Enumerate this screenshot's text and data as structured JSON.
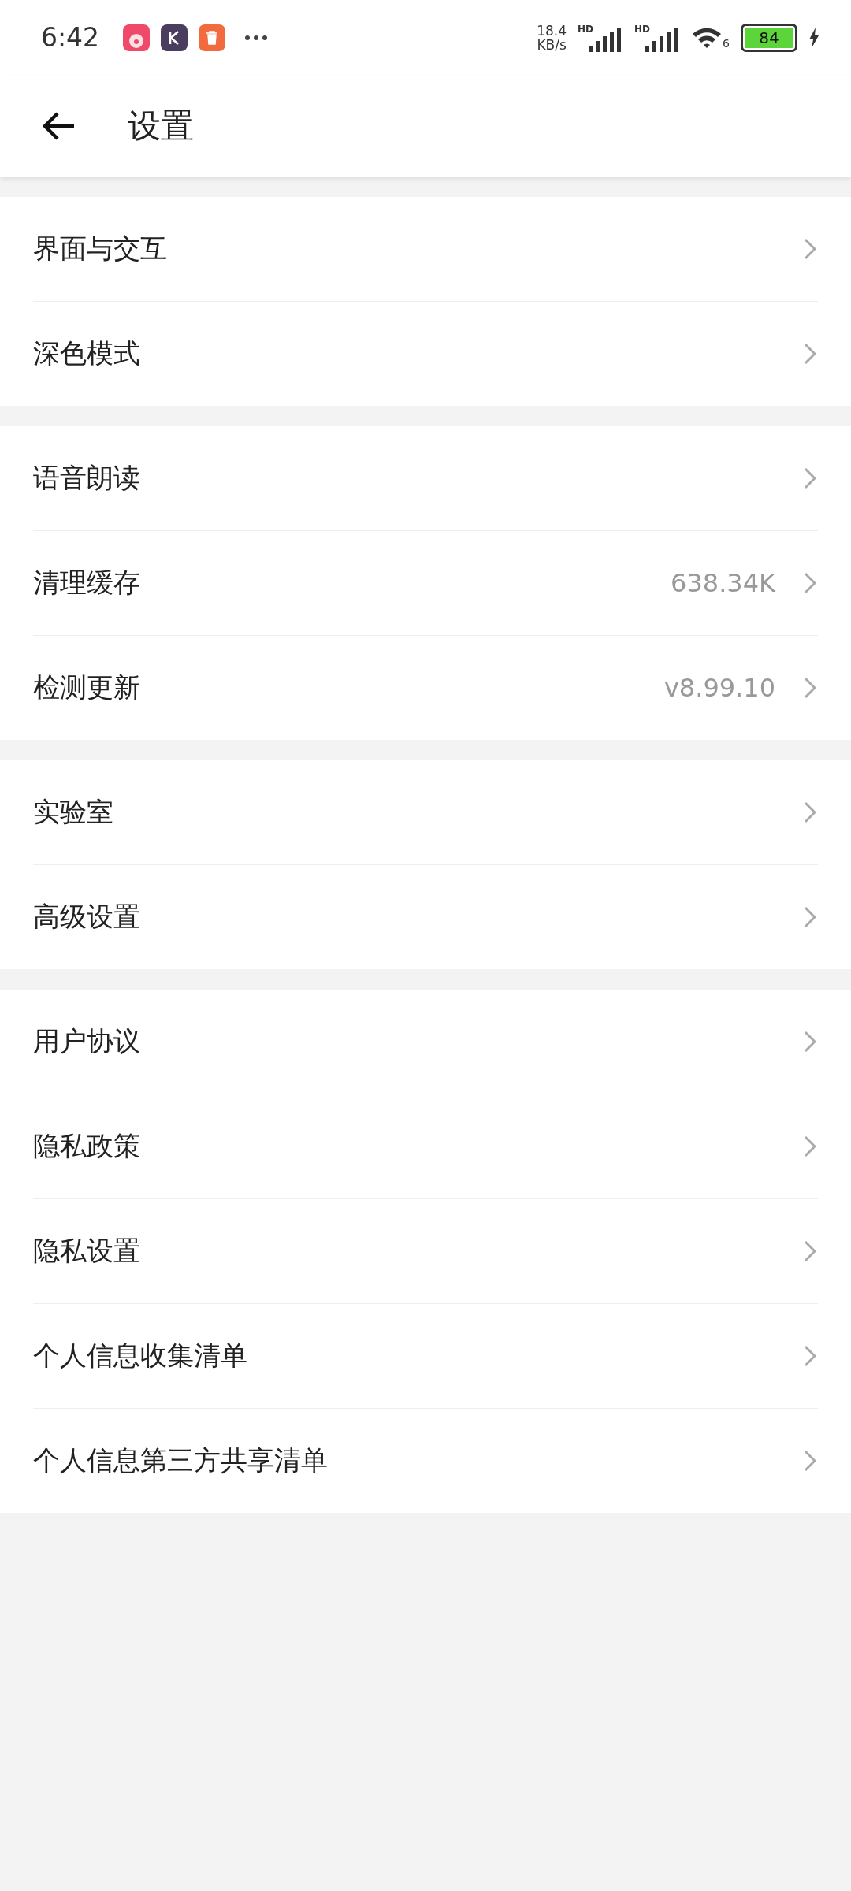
{
  "status_bar": {
    "time": "6:42",
    "net_speed": "18.4",
    "net_unit": "KB/s",
    "sim_labels": [
      "HD",
      "HD"
    ],
    "wifi_label": "6",
    "battery": "84"
  },
  "header": {
    "title": "设置"
  },
  "groups": [
    {
      "items": [
        {
          "label": "界面与交互"
        },
        {
          "label": "深色模式"
        }
      ]
    },
    {
      "items": [
        {
          "label": "语音朗读"
        },
        {
          "label": "清理缓存",
          "value": "638.34K"
        },
        {
          "label": "检测更新",
          "value": "v8.99.10"
        }
      ]
    },
    {
      "items": [
        {
          "label": "实验室"
        },
        {
          "label": "高级设置"
        }
      ]
    },
    {
      "items": [
        {
          "label": "用户协议"
        },
        {
          "label": "隐私政策"
        },
        {
          "label": "隐私设置"
        },
        {
          "label": "个人信息收集清单"
        },
        {
          "label": "个人信息第三方共享清单"
        }
      ]
    }
  ]
}
